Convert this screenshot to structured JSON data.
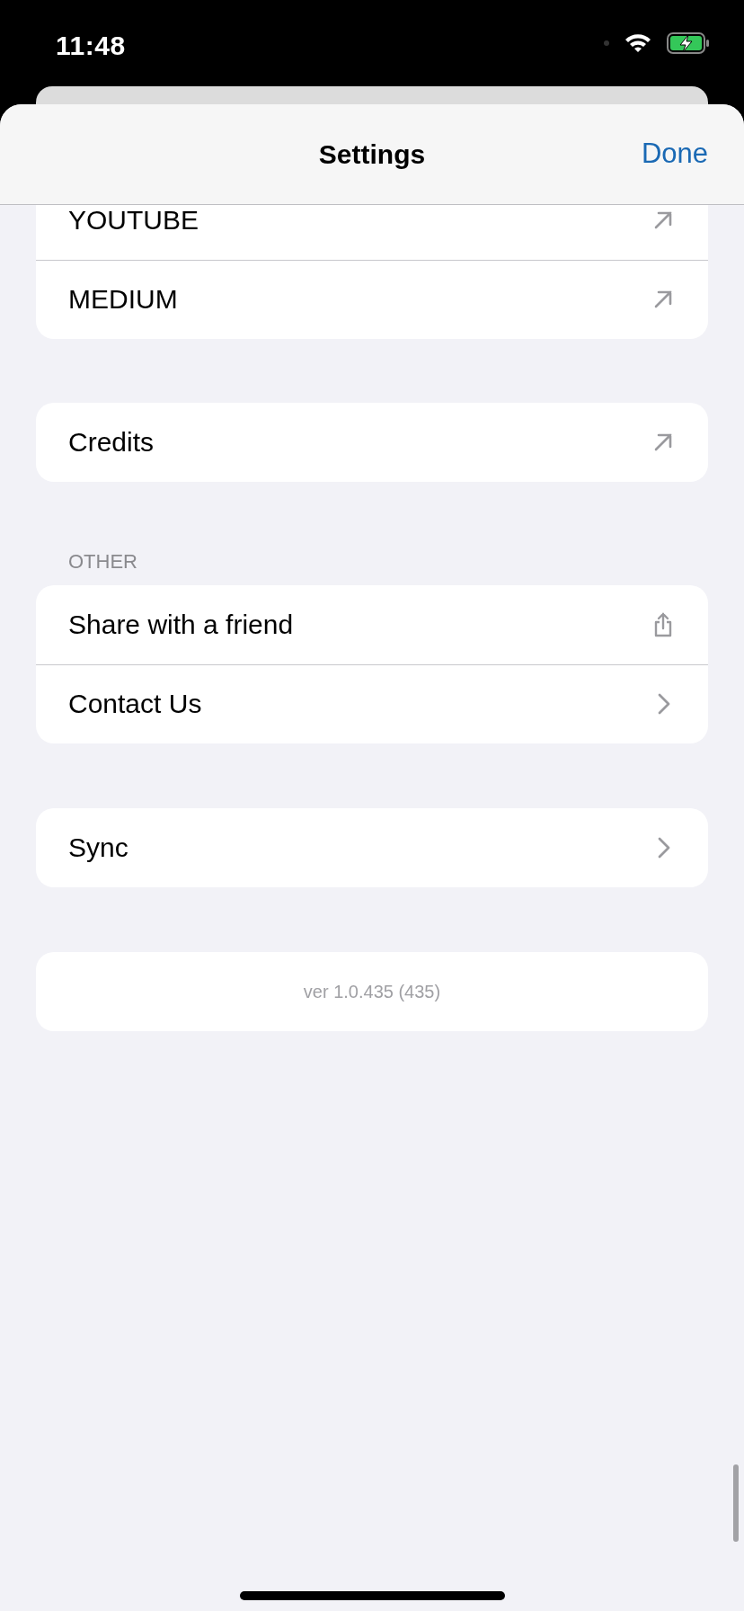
{
  "status_bar": {
    "time": "11:48"
  },
  "nav": {
    "title": "Settings",
    "action": "Done"
  },
  "sections": [
    {
      "rows": [
        {
          "label": "YOUTUBE",
          "kind": "external"
        },
        {
          "label": "MEDIUM",
          "kind": "external"
        }
      ]
    },
    {
      "rows": [
        {
          "label": "Credits",
          "kind": "external"
        }
      ]
    },
    {
      "header": "OTHER",
      "rows": [
        {
          "label": "Share with a friend",
          "kind": "share"
        },
        {
          "label": "Contact Us",
          "kind": "chevron"
        }
      ]
    },
    {
      "rows": [
        {
          "label": "Sync",
          "kind": "chevron"
        }
      ]
    },
    {
      "kind": "footer",
      "rows": [
        {
          "label": "ver 1.0.435 (435)"
        }
      ]
    }
  ]
}
